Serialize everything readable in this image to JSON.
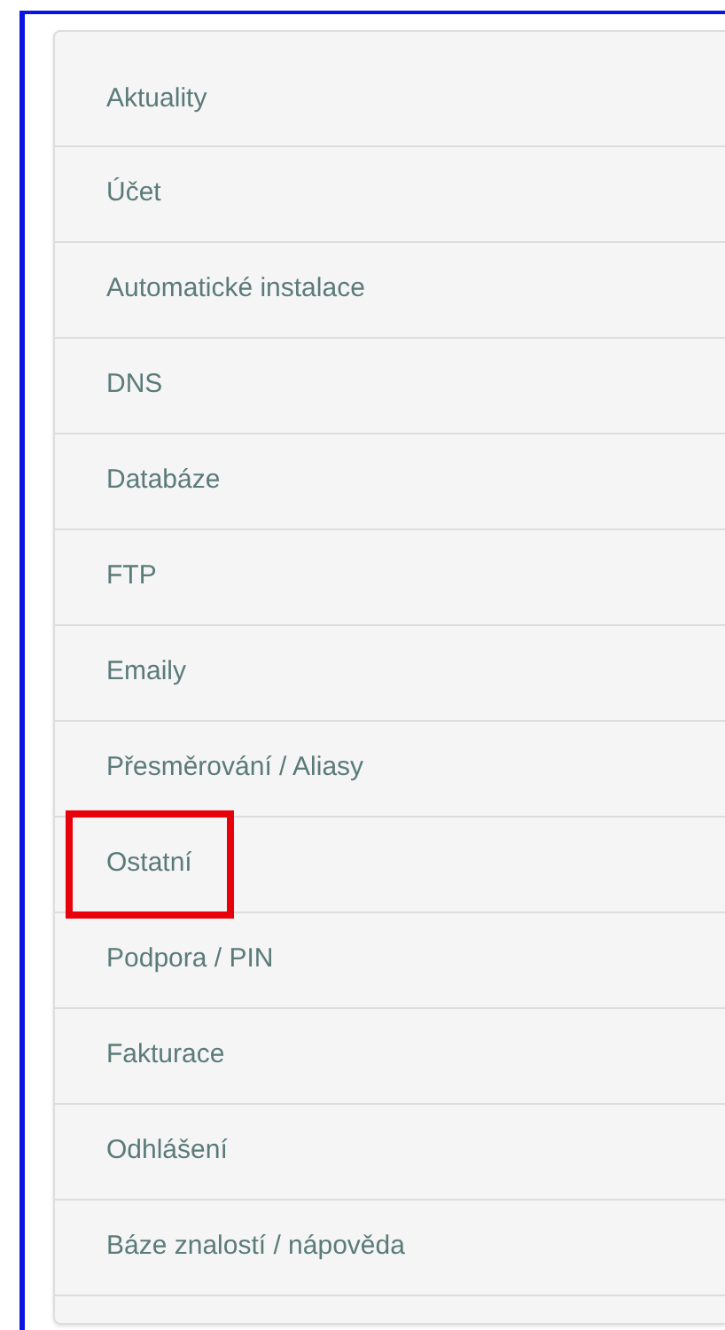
{
  "menu": {
    "items": [
      {
        "label": "Aktuality",
        "highlighted": false
      },
      {
        "label": "Účet",
        "highlighted": false
      },
      {
        "label": "Automatické instalace",
        "highlighted": false
      },
      {
        "label": "DNS",
        "highlighted": false
      },
      {
        "label": "Databáze",
        "highlighted": false
      },
      {
        "label": "FTP",
        "highlighted": false
      },
      {
        "label": "Emaily",
        "highlighted": false
      },
      {
        "label": "Přesměrování / Aliasy",
        "highlighted": false
      },
      {
        "label": "Ostatní",
        "highlighted": true
      },
      {
        "label": "Podpora / PIN",
        "highlighted": false
      },
      {
        "label": "Fakturace",
        "highlighted": false
      },
      {
        "label": "Odhlášení",
        "highlighted": false
      },
      {
        "label": "Báze znalostí / nápověda",
        "highlighted": false
      }
    ]
  }
}
